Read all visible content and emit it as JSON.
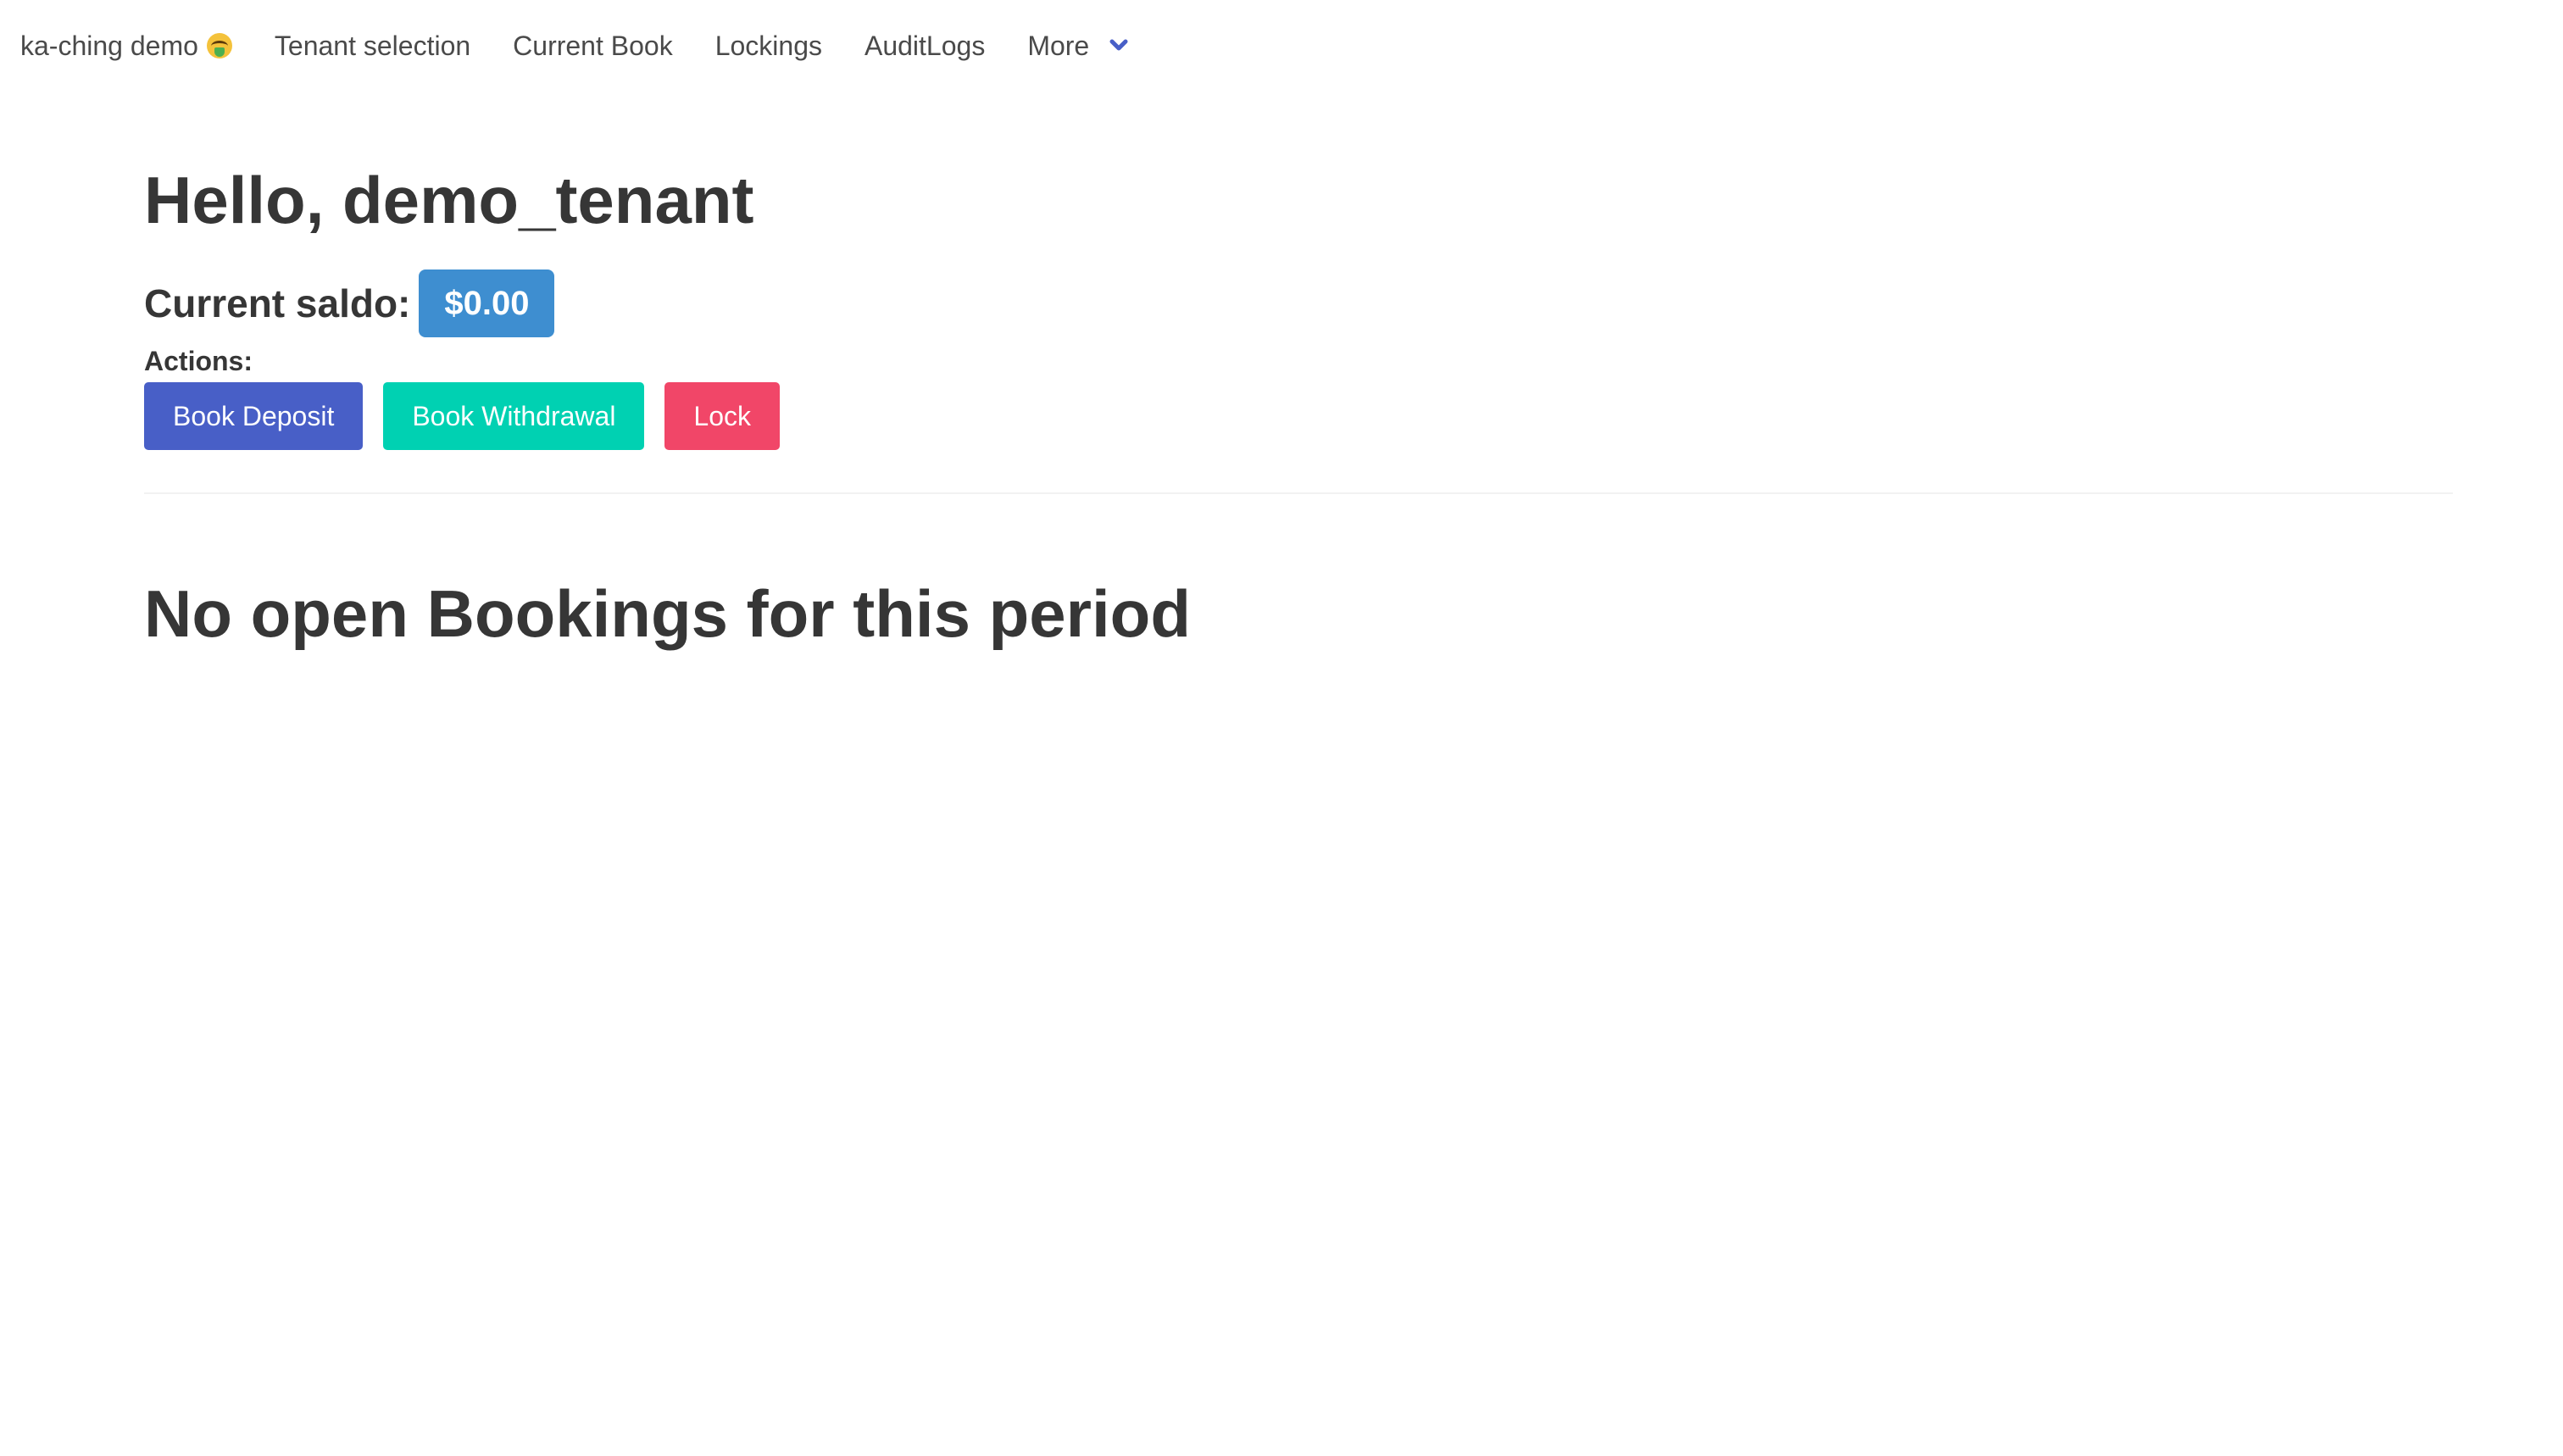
{
  "nav": {
    "brand": "ka-ching demo",
    "brand_emoji_icon": "money-mouth-face-icon",
    "items": [
      {
        "label": "Tenant selection"
      },
      {
        "label": "Current Book"
      },
      {
        "label": "Lockings"
      },
      {
        "label": "AuditLogs"
      },
      {
        "label": "More"
      }
    ],
    "more_icon": "chevron-down-icon",
    "accent_color": "#485fc7"
  },
  "main": {
    "greeting": "Hello, demo_tenant",
    "saldo_label": "Current saldo:",
    "saldo_value": "$0.00",
    "actions_label": "Actions:",
    "buttons": {
      "deposit": "Book Deposit",
      "withdrawal": "Book Withdrawal",
      "lock": "Lock"
    },
    "empty_message": "No open Bookings for this period"
  },
  "colors": {
    "saldo_tag": "#3e8ed0",
    "deposit": "#485fc7",
    "withdrawal": "#00d1b2",
    "lock": "#f14668",
    "text": "#363636"
  }
}
